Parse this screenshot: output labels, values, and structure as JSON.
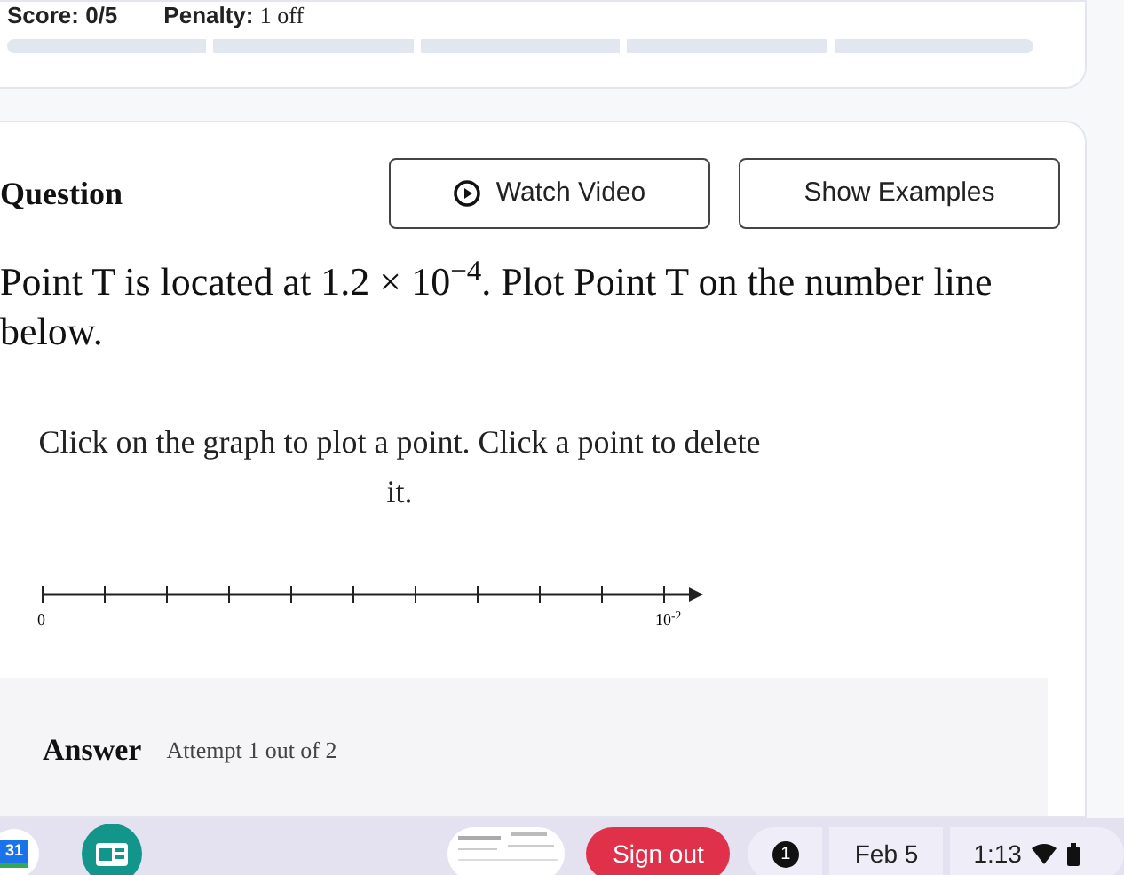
{
  "score_card": {
    "score_label": "Score:",
    "score": "0/5",
    "penalty_label": "Penalty:",
    "penalty": "1 off",
    "progress_segments": [
      {
        "filled": false
      },
      {
        "filled": false
      },
      {
        "filled": false
      },
      {
        "filled": false
      },
      {
        "filled": false
      }
    ]
  },
  "question": {
    "heading": "Question",
    "buttons": [
      {
        "kind": "video",
        "label": "Watch Video"
      },
      {
        "kind": "plain",
        "label": "Show Examples"
      }
    ],
    "prompt": "Point T is located at 1.2 × 10$^{−4}$. Plot Point T on the number line below.",
    "instruction": "Click on the graph to plot a point. Click a point to delete it.",
    "number_line": {
      "start_label": "0",
      "end_label": "10$^{-2}$"
    }
  },
  "answer": {
    "heading": "Answer",
    "attempt": "Attempt 1 out of 2"
  },
  "taskbar": {
    "sign_out": "Sign out",
    "notifications": "1",
    "date": "Feb 5",
    "time": "1:13",
    "calendar_day": "31"
  }
}
